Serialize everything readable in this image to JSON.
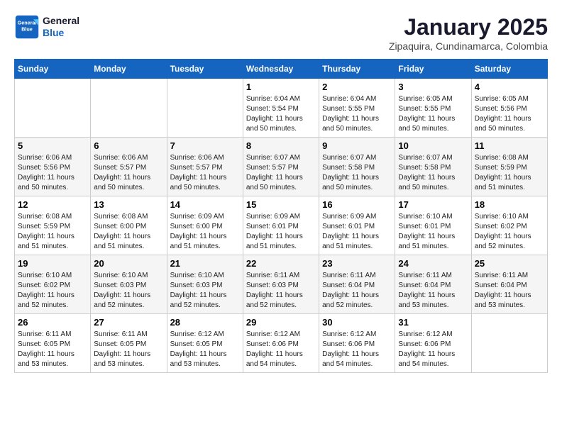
{
  "header": {
    "logo_line1": "General",
    "logo_line2": "Blue",
    "month_title": "January 2025",
    "location": "Zipaquira, Cundinamarca, Colombia"
  },
  "weekdays": [
    "Sunday",
    "Monday",
    "Tuesday",
    "Wednesday",
    "Thursday",
    "Friday",
    "Saturday"
  ],
  "weeks": [
    [
      {
        "day": "",
        "sunrise": "",
        "sunset": "",
        "daylight": ""
      },
      {
        "day": "",
        "sunrise": "",
        "sunset": "",
        "daylight": ""
      },
      {
        "day": "",
        "sunrise": "",
        "sunset": "",
        "daylight": ""
      },
      {
        "day": "1",
        "sunrise": "Sunrise: 6:04 AM",
        "sunset": "Sunset: 5:54 PM",
        "daylight": "Daylight: 11 hours and 50 minutes."
      },
      {
        "day": "2",
        "sunrise": "Sunrise: 6:04 AM",
        "sunset": "Sunset: 5:55 PM",
        "daylight": "Daylight: 11 hours and 50 minutes."
      },
      {
        "day": "3",
        "sunrise": "Sunrise: 6:05 AM",
        "sunset": "Sunset: 5:55 PM",
        "daylight": "Daylight: 11 hours and 50 minutes."
      },
      {
        "day": "4",
        "sunrise": "Sunrise: 6:05 AM",
        "sunset": "Sunset: 5:56 PM",
        "daylight": "Daylight: 11 hours and 50 minutes."
      }
    ],
    [
      {
        "day": "5",
        "sunrise": "Sunrise: 6:06 AM",
        "sunset": "Sunset: 5:56 PM",
        "daylight": "Daylight: 11 hours and 50 minutes."
      },
      {
        "day": "6",
        "sunrise": "Sunrise: 6:06 AM",
        "sunset": "Sunset: 5:57 PM",
        "daylight": "Daylight: 11 hours and 50 minutes."
      },
      {
        "day": "7",
        "sunrise": "Sunrise: 6:06 AM",
        "sunset": "Sunset: 5:57 PM",
        "daylight": "Daylight: 11 hours and 50 minutes."
      },
      {
        "day": "8",
        "sunrise": "Sunrise: 6:07 AM",
        "sunset": "Sunset: 5:57 PM",
        "daylight": "Daylight: 11 hours and 50 minutes."
      },
      {
        "day": "9",
        "sunrise": "Sunrise: 6:07 AM",
        "sunset": "Sunset: 5:58 PM",
        "daylight": "Daylight: 11 hours and 50 minutes."
      },
      {
        "day": "10",
        "sunrise": "Sunrise: 6:07 AM",
        "sunset": "Sunset: 5:58 PM",
        "daylight": "Daylight: 11 hours and 50 minutes."
      },
      {
        "day": "11",
        "sunrise": "Sunrise: 6:08 AM",
        "sunset": "Sunset: 5:59 PM",
        "daylight": "Daylight: 11 hours and 51 minutes."
      }
    ],
    [
      {
        "day": "12",
        "sunrise": "Sunrise: 6:08 AM",
        "sunset": "Sunset: 5:59 PM",
        "daylight": "Daylight: 11 hours and 51 minutes."
      },
      {
        "day": "13",
        "sunrise": "Sunrise: 6:08 AM",
        "sunset": "Sunset: 6:00 PM",
        "daylight": "Daylight: 11 hours and 51 minutes."
      },
      {
        "day": "14",
        "sunrise": "Sunrise: 6:09 AM",
        "sunset": "Sunset: 6:00 PM",
        "daylight": "Daylight: 11 hours and 51 minutes."
      },
      {
        "day": "15",
        "sunrise": "Sunrise: 6:09 AM",
        "sunset": "Sunset: 6:01 PM",
        "daylight": "Daylight: 11 hours and 51 minutes."
      },
      {
        "day": "16",
        "sunrise": "Sunrise: 6:09 AM",
        "sunset": "Sunset: 6:01 PM",
        "daylight": "Daylight: 11 hours and 51 minutes."
      },
      {
        "day": "17",
        "sunrise": "Sunrise: 6:10 AM",
        "sunset": "Sunset: 6:01 PM",
        "daylight": "Daylight: 11 hours and 51 minutes."
      },
      {
        "day": "18",
        "sunrise": "Sunrise: 6:10 AM",
        "sunset": "Sunset: 6:02 PM",
        "daylight": "Daylight: 11 hours and 52 minutes."
      }
    ],
    [
      {
        "day": "19",
        "sunrise": "Sunrise: 6:10 AM",
        "sunset": "Sunset: 6:02 PM",
        "daylight": "Daylight: 11 hours and 52 minutes."
      },
      {
        "day": "20",
        "sunrise": "Sunrise: 6:10 AM",
        "sunset": "Sunset: 6:03 PM",
        "daylight": "Daylight: 11 hours and 52 minutes."
      },
      {
        "day": "21",
        "sunrise": "Sunrise: 6:10 AM",
        "sunset": "Sunset: 6:03 PM",
        "daylight": "Daylight: 11 hours and 52 minutes."
      },
      {
        "day": "22",
        "sunrise": "Sunrise: 6:11 AM",
        "sunset": "Sunset: 6:03 PM",
        "daylight": "Daylight: 11 hours and 52 minutes."
      },
      {
        "day": "23",
        "sunrise": "Sunrise: 6:11 AM",
        "sunset": "Sunset: 6:04 PM",
        "daylight": "Daylight: 11 hours and 52 minutes."
      },
      {
        "day": "24",
        "sunrise": "Sunrise: 6:11 AM",
        "sunset": "Sunset: 6:04 PM",
        "daylight": "Daylight: 11 hours and 53 minutes."
      },
      {
        "day": "25",
        "sunrise": "Sunrise: 6:11 AM",
        "sunset": "Sunset: 6:04 PM",
        "daylight": "Daylight: 11 hours and 53 minutes."
      }
    ],
    [
      {
        "day": "26",
        "sunrise": "Sunrise: 6:11 AM",
        "sunset": "Sunset: 6:05 PM",
        "daylight": "Daylight: 11 hours and 53 minutes."
      },
      {
        "day": "27",
        "sunrise": "Sunrise: 6:11 AM",
        "sunset": "Sunset: 6:05 PM",
        "daylight": "Daylight: 11 hours and 53 minutes."
      },
      {
        "day": "28",
        "sunrise": "Sunrise: 6:12 AM",
        "sunset": "Sunset: 6:05 PM",
        "daylight": "Daylight: 11 hours and 53 minutes."
      },
      {
        "day": "29",
        "sunrise": "Sunrise: 6:12 AM",
        "sunset": "Sunset: 6:06 PM",
        "daylight": "Daylight: 11 hours and 54 minutes."
      },
      {
        "day": "30",
        "sunrise": "Sunrise: 6:12 AM",
        "sunset": "Sunset: 6:06 PM",
        "daylight": "Daylight: 11 hours and 54 minutes."
      },
      {
        "day": "31",
        "sunrise": "Sunrise: 6:12 AM",
        "sunset": "Sunset: 6:06 PM",
        "daylight": "Daylight: 11 hours and 54 minutes."
      },
      {
        "day": "",
        "sunrise": "",
        "sunset": "",
        "daylight": ""
      }
    ]
  ]
}
